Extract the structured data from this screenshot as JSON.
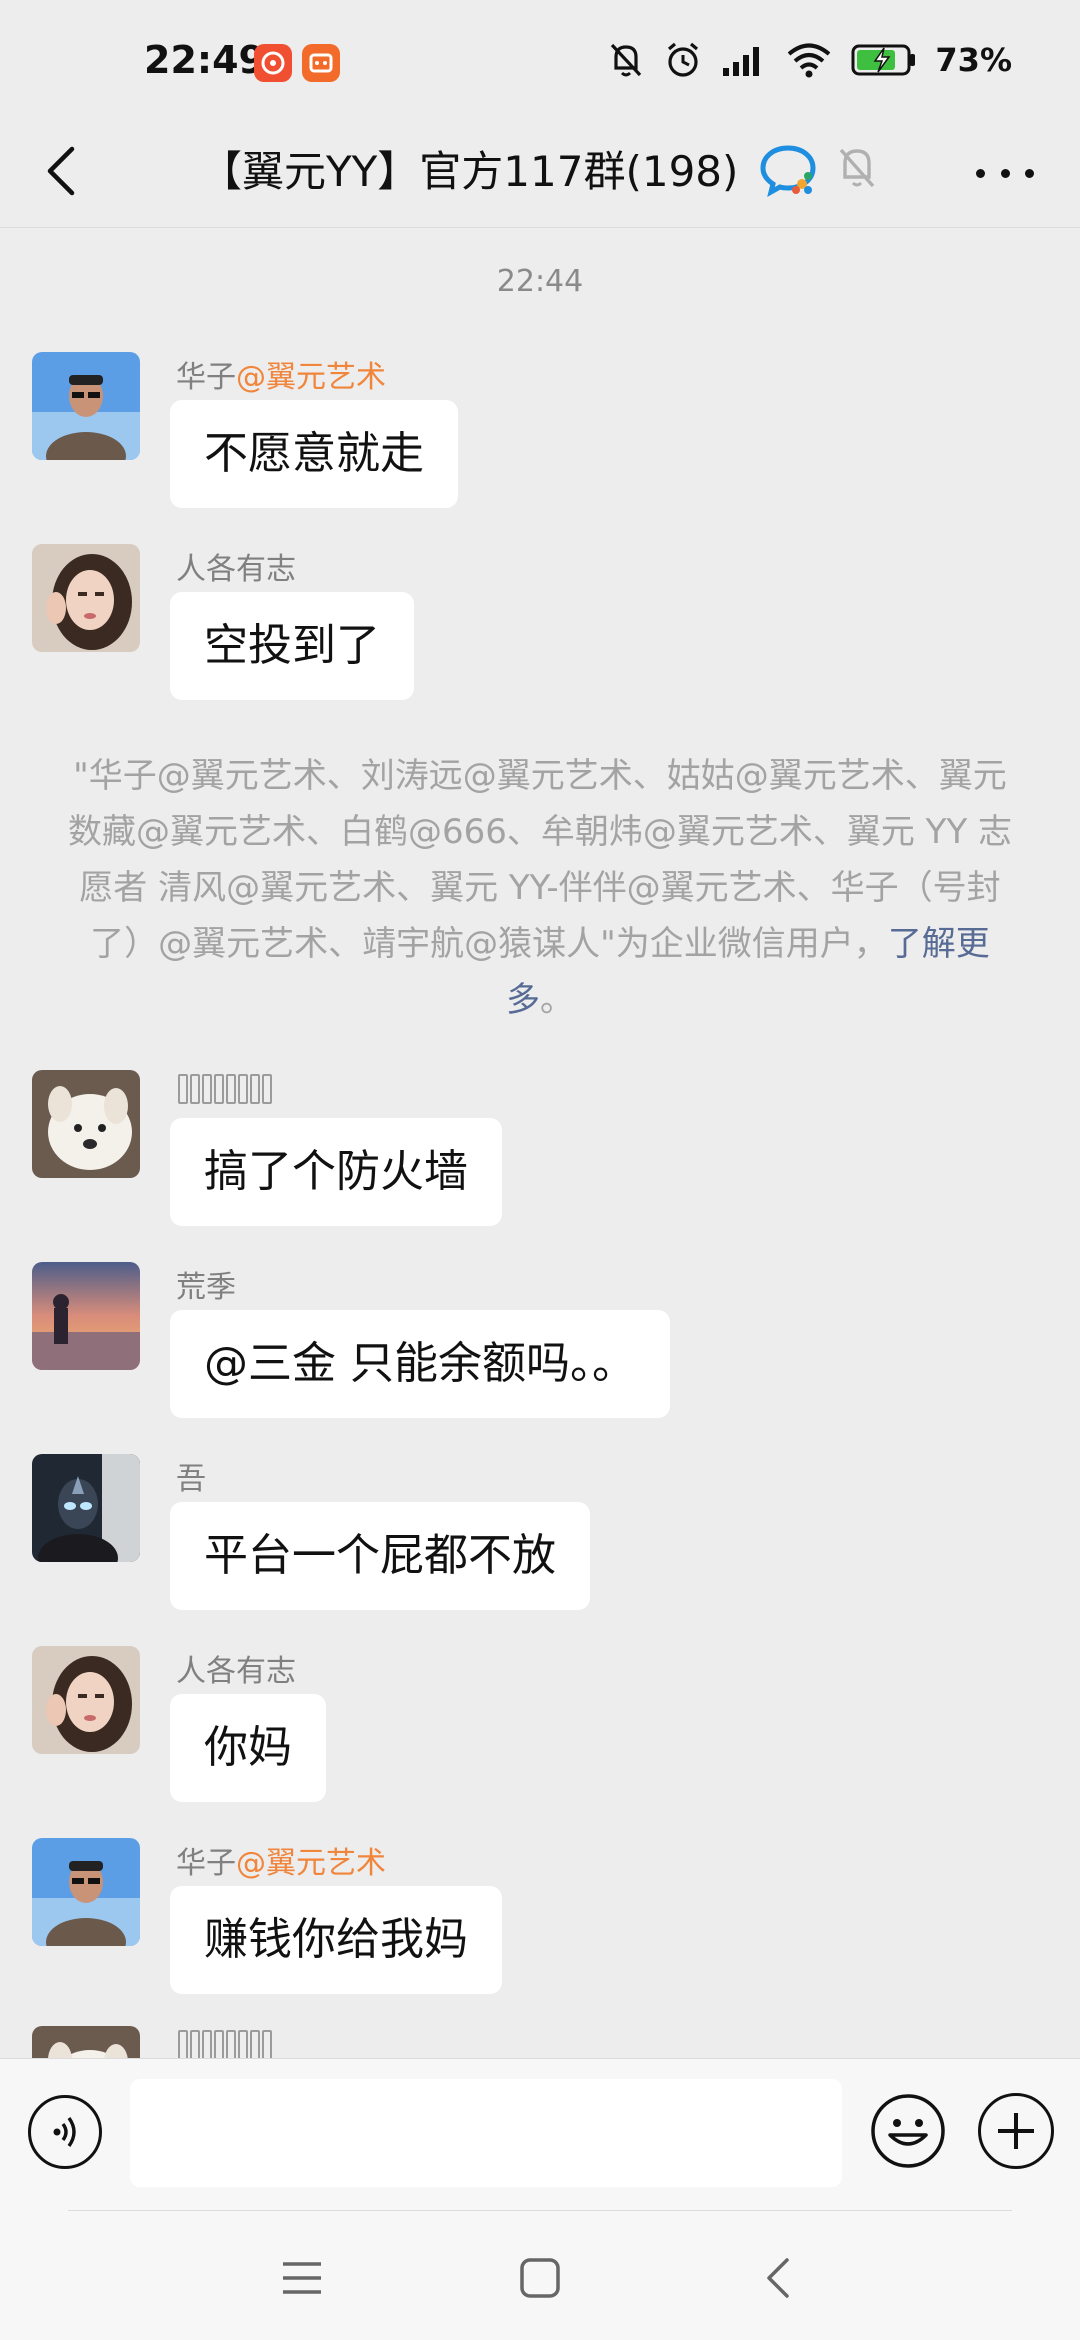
{
  "status_bar": {
    "time": "22:49",
    "battery_percent": "73%",
    "app_icon_colors": [
      "#f04f32",
      "#f26b2a"
    ]
  },
  "header": {
    "title": "【翼元YY】官方117群(198)",
    "back_icon": "chevron-left-icon",
    "wecom_icon": "wecom-chat-icon",
    "mute_icon": "bell-off-icon",
    "more_icon": "more-dots-icon"
  },
  "timestamp": "22:44",
  "messages": [
    {
      "sender": "华子",
      "sender_tag": "@翼元艺术",
      "text": "不愿意就走",
      "avatar": "avatar-man-sky"
    },
    {
      "sender": "人各有志",
      "sender_tag": "",
      "text": "空投到了",
      "avatar": "avatar-woman"
    },
    {
      "sender": "",
      "sender_tag": "",
      "text": "搞了个防火墙",
      "avatar": "avatar-dog"
    },
    {
      "sender": "荒季",
      "sender_tag": "",
      "text": "@三金  只能余额吗。。",
      "avatar": "avatar-sunset"
    },
    {
      "sender": "吾",
      "sender_tag": "",
      "text": "平台一个屁都不放",
      "avatar": "avatar-ultraman"
    },
    {
      "sender": "人各有志",
      "sender_tag": "",
      "text": "你妈",
      "avatar": "avatar-woman"
    },
    {
      "sender": "华子",
      "sender_tag": "@翼元艺术",
      "text": "赚钱你给我妈",
      "avatar": "avatar-man-sky"
    }
  ],
  "system_notice": {
    "text": "\"华子@翼元艺术、刘涛远@翼元艺术、姑姑@翼元艺术、翼元数藏@翼元艺术、白鹤@666、牟朝炜@翼元艺术、翼元 YY 志愿者 清风@翼元艺术、翼元 YY-伴伴@翼元艺术、华子（号封了）@翼元艺术、靖宇航@猿谋人\"为企业微信用户，",
    "link": "了解更多",
    "suffix": "。"
  },
  "input_bar": {
    "voice_icon": "voice-icon",
    "input_value": "",
    "emoji_icon": "emoji-icon",
    "plus_icon": "plus-icon"
  },
  "nav_bar": {
    "menu_icon": "menu-icon",
    "home_icon": "home-square-icon",
    "back_icon": "back-chevron-icon"
  }
}
